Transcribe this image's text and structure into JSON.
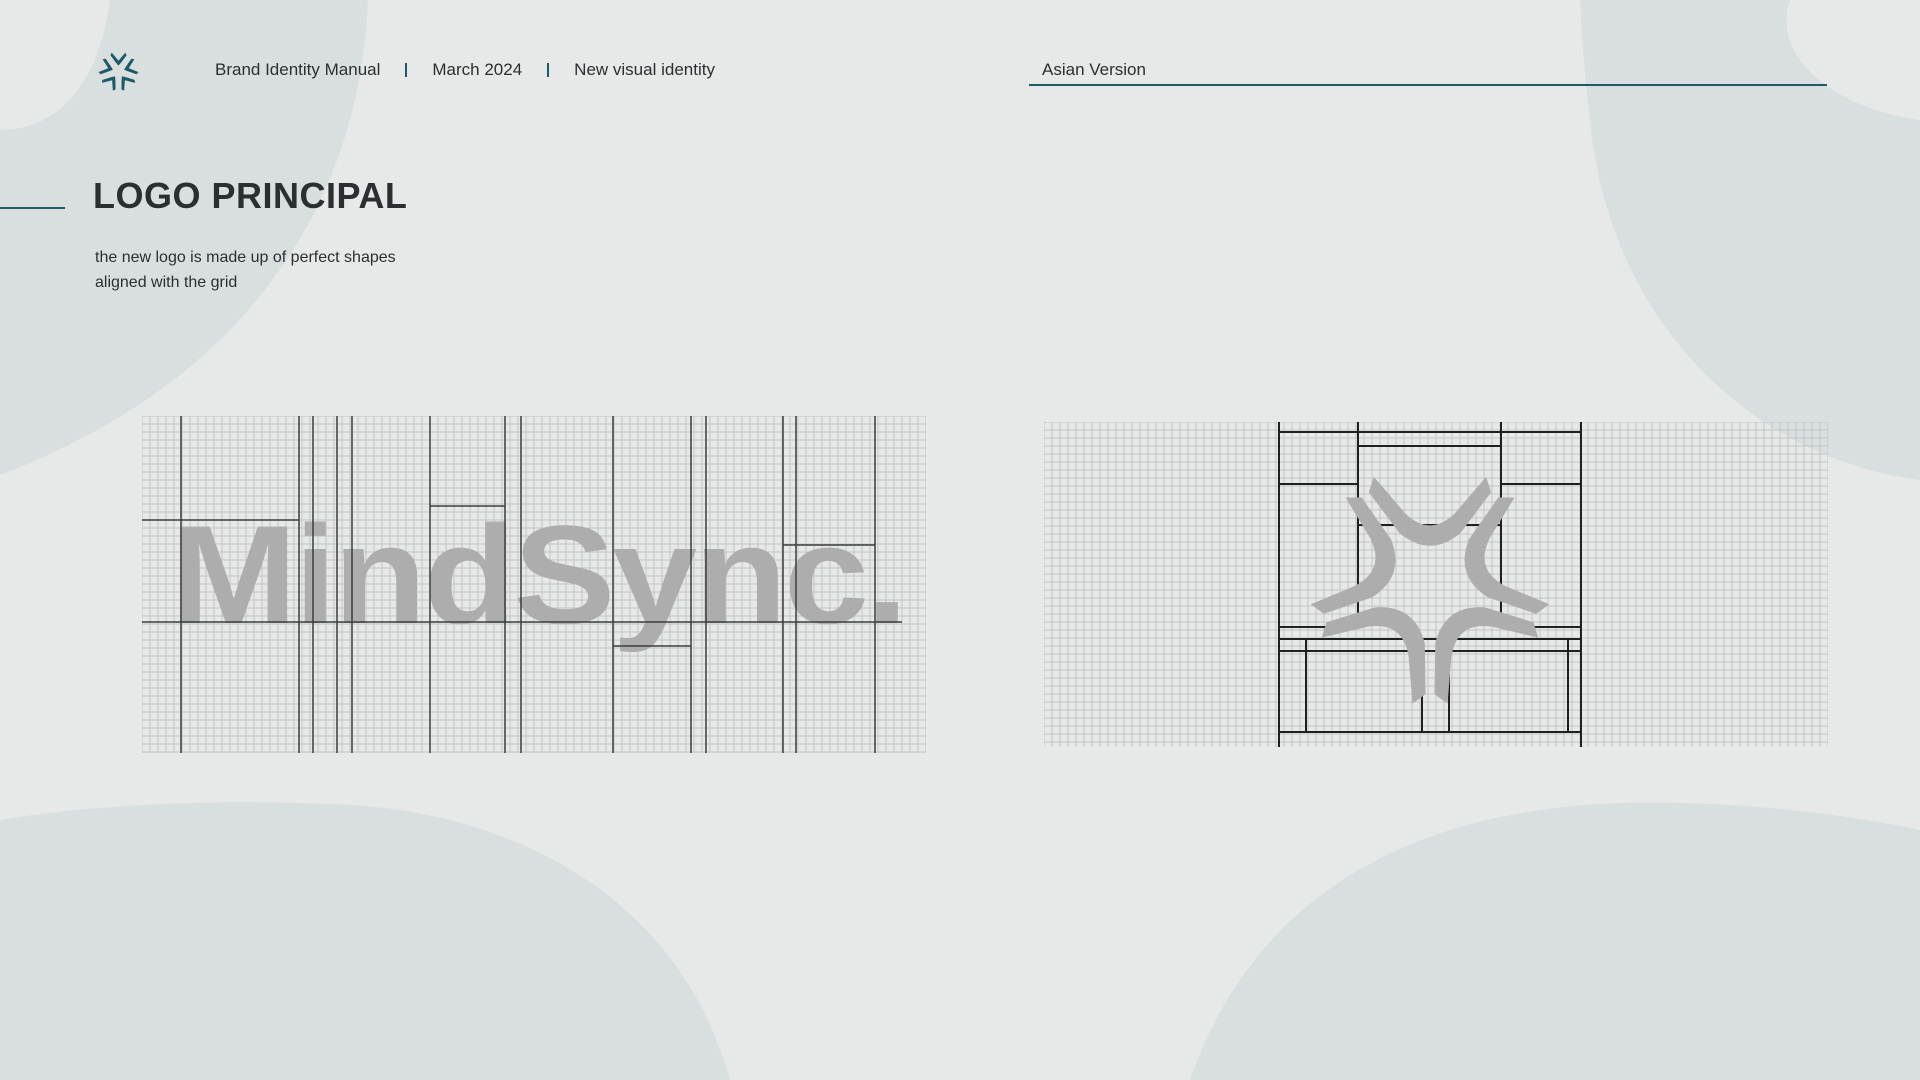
{
  "header": {
    "manual": "Brand Identity Manual",
    "date": "March 2024",
    "subtitle": "New visual identity",
    "version": "Asian Version"
  },
  "section": {
    "title": "LOGO PRINCIPAL",
    "description_line1": "the new logo is made up of perfect shapes",
    "description_line2": "aligned with the grid"
  },
  "wordmark": {
    "text": "MindSync."
  },
  "colors": {
    "background": "#e7e8e8",
    "accent": "#1d5a68",
    "shape_bg": "#d9dfdf",
    "logo_gray": "#adadad",
    "grid": "#c3c3c3"
  },
  "icons": {
    "brand_mark": "mindsync-symbol-icon"
  }
}
